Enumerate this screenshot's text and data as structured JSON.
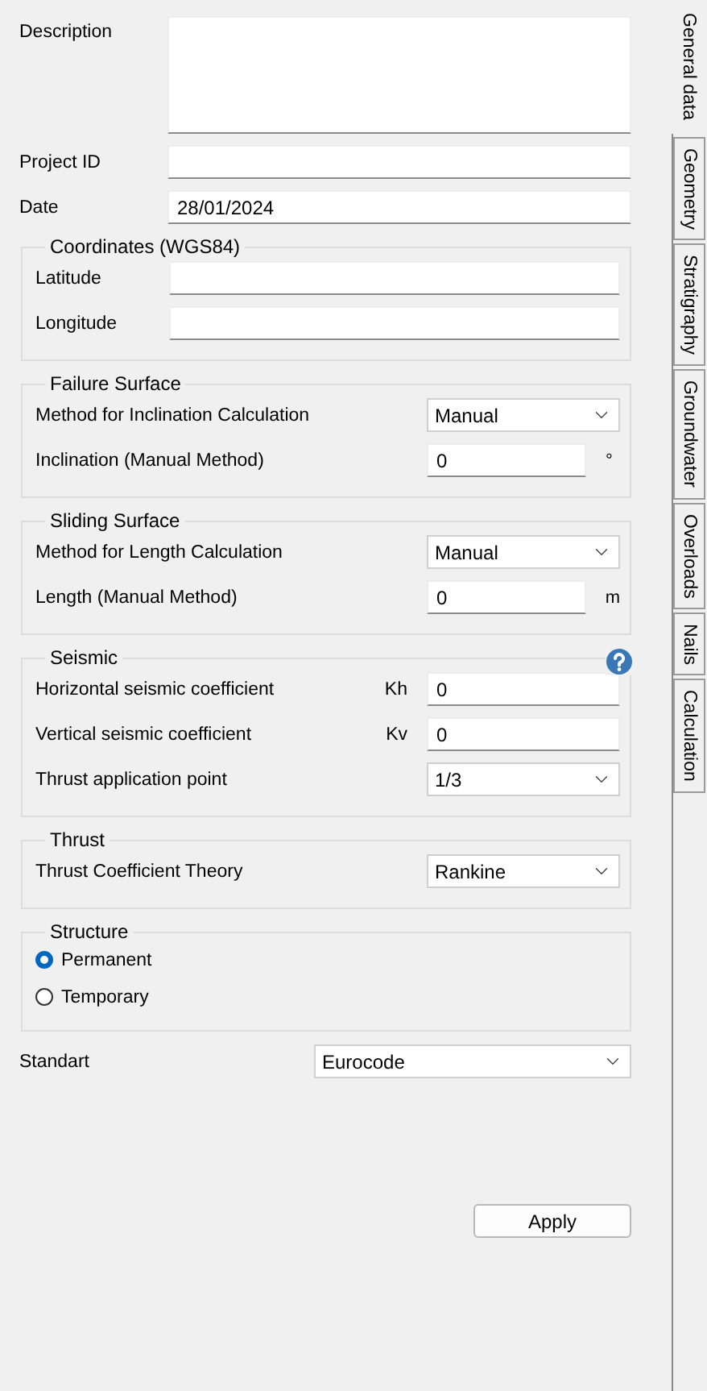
{
  "form": [
    {
      "label": "Description",
      "kind": "textarea"
    },
    {
      "label": "Project ID",
      "kind": "text"
    },
    {
      "label": "Date",
      "kind": "text",
      "value": "28/01/2024"
    }
  ],
  "groups": [
    {
      "title": "Coordinates (WGS84)",
      "rows": [
        {
          "label": "Latitude",
          "kind": "wide_text"
        },
        {
          "label": "Longitude",
          "kind": "wide_text"
        }
      ]
    },
    {
      "title": "Failure Surface",
      "rows": [
        {
          "label": "Method for Inclination Calculation",
          "kind": "select",
          "value": "Manual"
        },
        {
          "label": "Inclination (Manual Method)",
          "kind": "text",
          "value": "0",
          "unit": "°"
        }
      ]
    },
    {
      "title": "Sliding Surface",
      "rows": [
        {
          "label": "Method for Length Calculation",
          "kind": "select",
          "value": "Manual"
        },
        {
          "label": "Length (Manual Method)",
          "kind": "text",
          "value": "0",
          "unit": "m"
        }
      ]
    },
    {
      "title": "Seismic",
      "help": true,
      "rows": [
        {
          "label": "Horizontal seismic coefficient",
          "symbol": "Kh",
          "kind": "text",
          "value": "0"
        },
        {
          "label": "Vertical seismic coefficient",
          "symbol": "Kv",
          "kind": "text",
          "value": "0"
        },
        {
          "label": "Thrust application point",
          "kind": "select",
          "value": "1/3"
        }
      ]
    },
    {
      "title": "Thrust",
      "rows": [
        {
          "label": "Thrust Coefficient Theory",
          "kind": "select",
          "value": "Rankine"
        }
      ]
    },
    {
      "title": "Structure",
      "rows": [
        {
          "label": "Permanent",
          "kind": "radio",
          "selected": true
        },
        {
          "label": "Temporary",
          "kind": "radio",
          "selected": false
        }
      ]
    }
  ],
  "standard": {
    "label": "Standart",
    "value": "Eurocode"
  },
  "apply_button": "Apply",
  "tabs": [
    {
      "label": "General data",
      "selected": true
    },
    {
      "label": "Geometry",
      "selected": false
    },
    {
      "label": "Stratigraphy",
      "selected": false
    },
    {
      "label": "Groundwater",
      "selected": false
    },
    {
      "label": "Overloads",
      "selected": false
    },
    {
      "label": "Nails",
      "selected": false
    },
    {
      "label": "Calculation",
      "selected": false
    }
  ]
}
